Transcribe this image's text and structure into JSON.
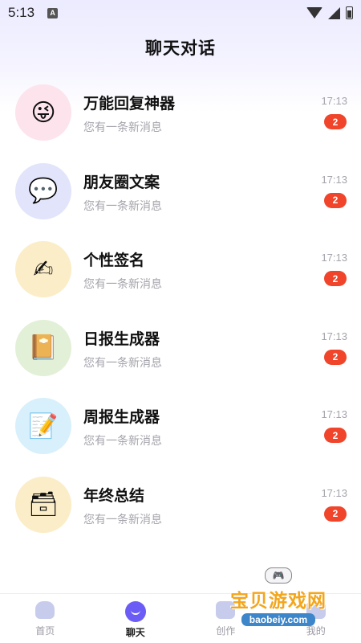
{
  "status_bar": {
    "time": "5:13",
    "notification_icon_letter": "A"
  },
  "header": {
    "title": "聊天对话"
  },
  "chats": [
    {
      "name": "万能回复神器",
      "preview": "您有一条新消息",
      "time": "17:13",
      "badge": "2",
      "avatar_icon": "face-with-tongue-emoji",
      "avatar_glyph": "😜",
      "avatar_bg": "#fde3ec"
    },
    {
      "name": "朋友圈文案",
      "preview": "您有一条新消息",
      "time": "17:13",
      "badge": "2",
      "avatar_icon": "speech-bubble-emoji",
      "avatar_glyph": "💬",
      "avatar_bg": "#e2e4fb"
    },
    {
      "name": "个性签名",
      "preview": "您有一条新消息",
      "time": "17:13",
      "badge": "2",
      "avatar_icon": "writing-hand-emoji",
      "avatar_glyph": "✍",
      "avatar_bg": "#fbedc7"
    },
    {
      "name": "日报生成器",
      "preview": "您有一条新消息",
      "time": "17:13",
      "badge": "2",
      "avatar_icon": "notebook-emoji",
      "avatar_glyph": "📔",
      "avatar_bg": "#e3f0d8"
    },
    {
      "name": "周报生成器",
      "preview": "您有一条新消息",
      "time": "17:13",
      "badge": "2",
      "avatar_icon": "memo-emoji",
      "avatar_glyph": "📝",
      "avatar_bg": "#d8f0fb"
    },
    {
      "name": "年终总结",
      "preview": "您有一条新消息",
      "time": "17:13",
      "badge": "2",
      "avatar_icon": "file-cabinet-emoji",
      "avatar_glyph": "🗃",
      "avatar_bg": "#fbedc7"
    }
  ],
  "tab_bar": {
    "tabs": [
      {
        "label": "首页",
        "icon": "home-icon",
        "active": false
      },
      {
        "label": "聊天",
        "icon": "chat-smile-icon",
        "active": true
      },
      {
        "label": "创作",
        "icon": "create-icon",
        "active": false
      },
      {
        "label": "我的",
        "icon": "profile-icon",
        "active": false
      }
    ]
  },
  "watermark": {
    "title": "宝贝游戏网",
    "url": "baobeiy.com"
  },
  "colors": {
    "accent": "#6b5cf6",
    "badge": "#f0452b",
    "watermark_title": "#f3a61c"
  }
}
